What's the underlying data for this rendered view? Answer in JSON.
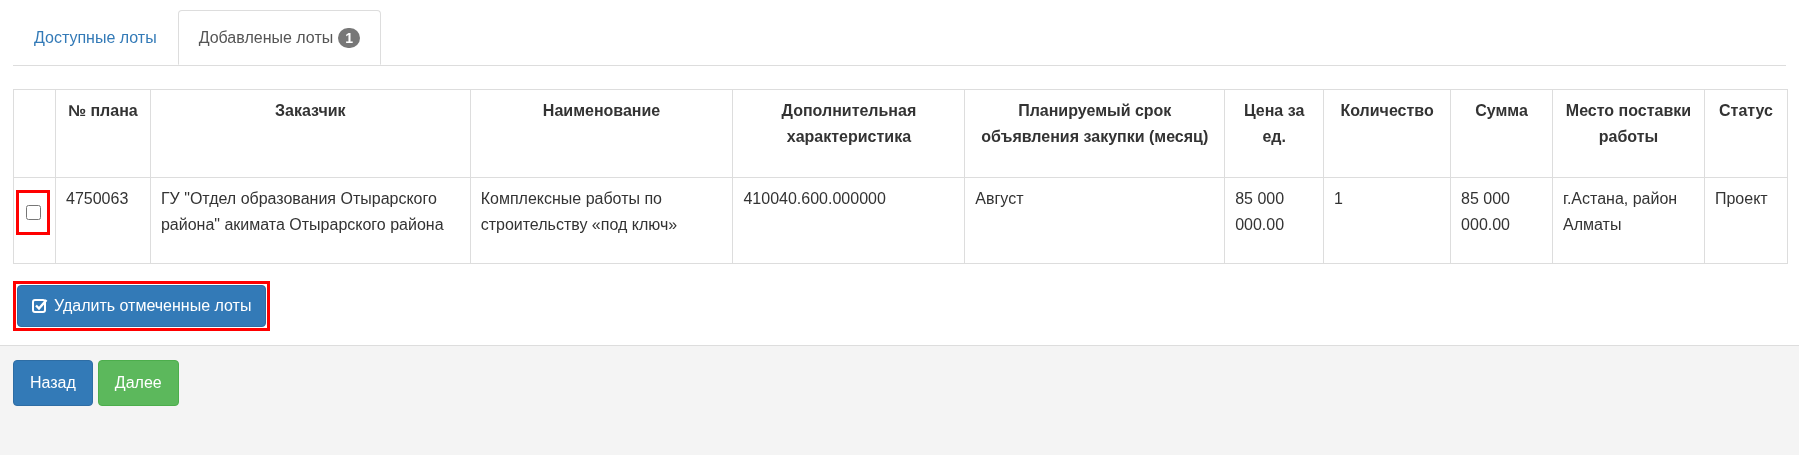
{
  "tabs": [
    {
      "label": "Доступные лоты",
      "selected": false
    },
    {
      "label": "Добавленые лоты",
      "badge": "1",
      "selected": true
    }
  ],
  "table": {
    "columns": [
      "№ плана",
      "Заказчик",
      "Наименование",
      "Дополнительная характеристика",
      "Планируемый срок объявления закупки (месяц)",
      "Цена за ед.",
      "Количество",
      "Сумма",
      "Место поставки работы",
      "Статус"
    ],
    "rows": [
      {
        "checked": false,
        "highlighted": true,
        "cells": [
          "4750063",
          "ГУ \"Отдел образования Отырарского района\" акимата Отырарского района",
          "Комплексные работы по строительству «под ключ»",
          "410040.600.000000",
          "Август",
          "85 000 000.00",
          "1",
          "85 000 000.00",
          "г.Астана, район Алматы",
          "Проект"
        ]
      }
    ]
  },
  "delete_button": {
    "label": "Удалить отмеченные лоты",
    "highlighted": true
  },
  "footer_buttons": [
    {
      "label": "Назад",
      "kind": "primary"
    },
    {
      "label": "Далее",
      "kind": "success"
    }
  ]
}
